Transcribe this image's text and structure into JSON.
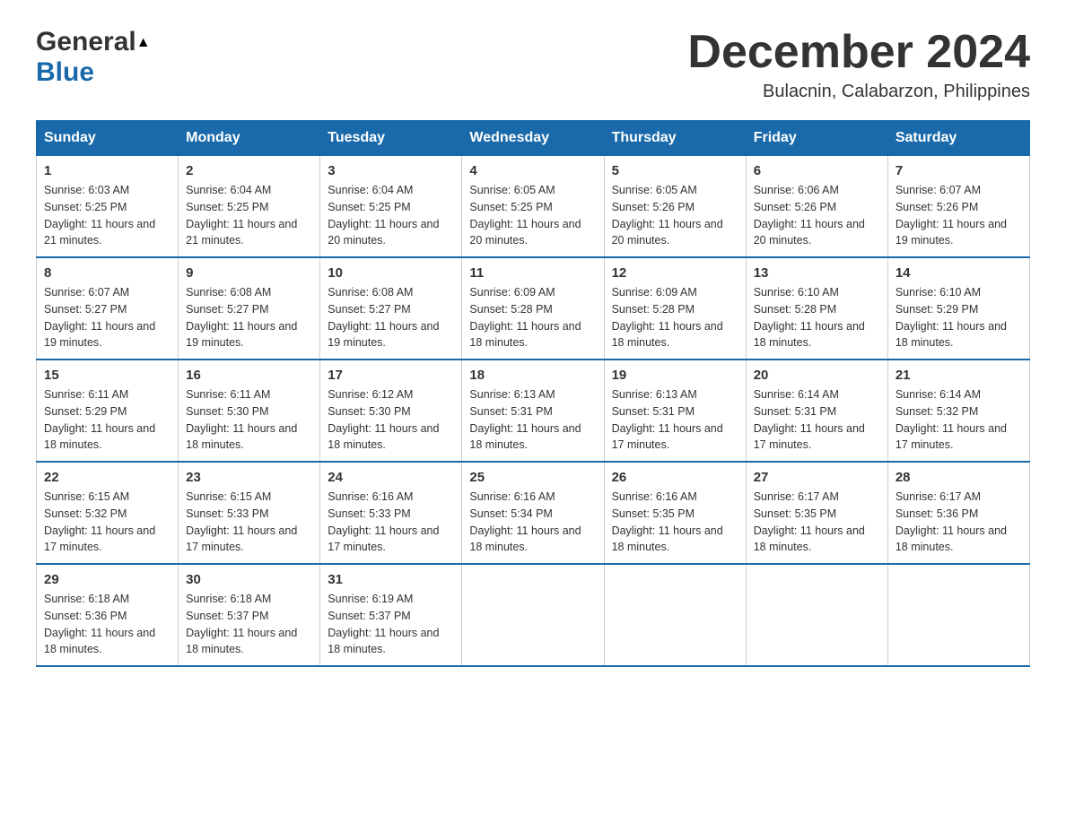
{
  "logo": {
    "line1": "General",
    "line2": "Blue"
  },
  "title": "December 2024",
  "subtitle": "Bulacnin, Calabarzon, Philippines",
  "days": [
    "Sunday",
    "Monday",
    "Tuesday",
    "Wednesday",
    "Thursday",
    "Friday",
    "Saturday"
  ],
  "weeks": [
    [
      {
        "day": "1",
        "sunrise": "6:03 AM",
        "sunset": "5:25 PM",
        "daylight": "11 hours and 21 minutes."
      },
      {
        "day": "2",
        "sunrise": "6:04 AM",
        "sunset": "5:25 PM",
        "daylight": "11 hours and 21 minutes."
      },
      {
        "day": "3",
        "sunrise": "6:04 AM",
        "sunset": "5:25 PM",
        "daylight": "11 hours and 20 minutes."
      },
      {
        "day": "4",
        "sunrise": "6:05 AM",
        "sunset": "5:25 PM",
        "daylight": "11 hours and 20 minutes."
      },
      {
        "day": "5",
        "sunrise": "6:05 AM",
        "sunset": "5:26 PM",
        "daylight": "11 hours and 20 minutes."
      },
      {
        "day": "6",
        "sunrise": "6:06 AM",
        "sunset": "5:26 PM",
        "daylight": "11 hours and 20 minutes."
      },
      {
        "day": "7",
        "sunrise": "6:07 AM",
        "sunset": "5:26 PM",
        "daylight": "11 hours and 19 minutes."
      }
    ],
    [
      {
        "day": "8",
        "sunrise": "6:07 AM",
        "sunset": "5:27 PM",
        "daylight": "11 hours and 19 minutes."
      },
      {
        "day": "9",
        "sunrise": "6:08 AM",
        "sunset": "5:27 PM",
        "daylight": "11 hours and 19 minutes."
      },
      {
        "day": "10",
        "sunrise": "6:08 AM",
        "sunset": "5:27 PM",
        "daylight": "11 hours and 19 minutes."
      },
      {
        "day": "11",
        "sunrise": "6:09 AM",
        "sunset": "5:28 PM",
        "daylight": "11 hours and 18 minutes."
      },
      {
        "day": "12",
        "sunrise": "6:09 AM",
        "sunset": "5:28 PM",
        "daylight": "11 hours and 18 minutes."
      },
      {
        "day": "13",
        "sunrise": "6:10 AM",
        "sunset": "5:28 PM",
        "daylight": "11 hours and 18 minutes."
      },
      {
        "day": "14",
        "sunrise": "6:10 AM",
        "sunset": "5:29 PM",
        "daylight": "11 hours and 18 minutes."
      }
    ],
    [
      {
        "day": "15",
        "sunrise": "6:11 AM",
        "sunset": "5:29 PM",
        "daylight": "11 hours and 18 minutes."
      },
      {
        "day": "16",
        "sunrise": "6:11 AM",
        "sunset": "5:30 PM",
        "daylight": "11 hours and 18 minutes."
      },
      {
        "day": "17",
        "sunrise": "6:12 AM",
        "sunset": "5:30 PM",
        "daylight": "11 hours and 18 minutes."
      },
      {
        "day": "18",
        "sunrise": "6:13 AM",
        "sunset": "5:31 PM",
        "daylight": "11 hours and 18 minutes."
      },
      {
        "day": "19",
        "sunrise": "6:13 AM",
        "sunset": "5:31 PM",
        "daylight": "11 hours and 17 minutes."
      },
      {
        "day": "20",
        "sunrise": "6:14 AM",
        "sunset": "5:31 PM",
        "daylight": "11 hours and 17 minutes."
      },
      {
        "day": "21",
        "sunrise": "6:14 AM",
        "sunset": "5:32 PM",
        "daylight": "11 hours and 17 minutes."
      }
    ],
    [
      {
        "day": "22",
        "sunrise": "6:15 AM",
        "sunset": "5:32 PM",
        "daylight": "11 hours and 17 minutes."
      },
      {
        "day": "23",
        "sunrise": "6:15 AM",
        "sunset": "5:33 PM",
        "daylight": "11 hours and 17 minutes."
      },
      {
        "day": "24",
        "sunrise": "6:16 AM",
        "sunset": "5:33 PM",
        "daylight": "11 hours and 17 minutes."
      },
      {
        "day": "25",
        "sunrise": "6:16 AM",
        "sunset": "5:34 PM",
        "daylight": "11 hours and 18 minutes."
      },
      {
        "day": "26",
        "sunrise": "6:16 AM",
        "sunset": "5:35 PM",
        "daylight": "11 hours and 18 minutes."
      },
      {
        "day": "27",
        "sunrise": "6:17 AM",
        "sunset": "5:35 PM",
        "daylight": "11 hours and 18 minutes."
      },
      {
        "day": "28",
        "sunrise": "6:17 AM",
        "sunset": "5:36 PM",
        "daylight": "11 hours and 18 minutes."
      }
    ],
    [
      {
        "day": "29",
        "sunrise": "6:18 AM",
        "sunset": "5:36 PM",
        "daylight": "11 hours and 18 minutes."
      },
      {
        "day": "30",
        "sunrise": "6:18 AM",
        "sunset": "5:37 PM",
        "daylight": "11 hours and 18 minutes."
      },
      {
        "day": "31",
        "sunrise": "6:19 AM",
        "sunset": "5:37 PM",
        "daylight": "11 hours and 18 minutes."
      },
      null,
      null,
      null,
      null
    ]
  ],
  "labels": {
    "sunrise": "Sunrise:",
    "sunset": "Sunset:",
    "daylight": "Daylight:"
  }
}
